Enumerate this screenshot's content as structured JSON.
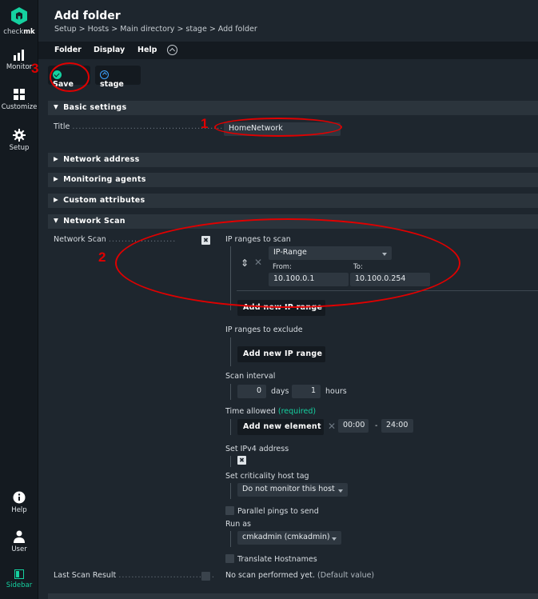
{
  "sidebar": {
    "logo_label_prefix": "check",
    "logo_label_suffix": "mk",
    "items": [
      {
        "label": "Monitor",
        "icon": "bar-chart-icon"
      },
      {
        "label": "Customize",
        "icon": "grid-icon"
      },
      {
        "label": "Setup",
        "icon": "gear-icon"
      },
      {
        "label": "Help",
        "icon": "info-icon"
      },
      {
        "label": "User",
        "icon": "user-icon"
      },
      {
        "label": "Sidebar",
        "icon": "sidebar-toggle-icon"
      }
    ]
  },
  "header": {
    "title": "Add folder",
    "breadcrumb": "Setup > Hosts > Main directory > stage > Add folder"
  },
  "menubar": {
    "items": [
      "Folder",
      "Display",
      "Help"
    ]
  },
  "toolbar": {
    "save_label": "Save",
    "stage_label": "stage"
  },
  "sections": {
    "basic": "Basic settings",
    "network_address": "Network address",
    "monitoring_agents": "Monitoring agents",
    "custom_attributes": "Custom attributes",
    "network_scan": "Network Scan"
  },
  "form": {
    "title_label": "Title",
    "title_dots": "...............................................",
    "title_value": "HomeNetwork",
    "network_scan_label": "Network Scan",
    "network_scan_dots": ".....................",
    "ip_ranges_to_scan": "IP ranges to scan",
    "range_type": "IP-Range",
    "from_label": "From:",
    "to_label": "To:",
    "from_value": "10.100.0.1",
    "to_value": "10.100.0.254",
    "add_ip_range": "Add new IP range",
    "ip_ranges_to_exclude": "IP ranges to exclude",
    "add_ip_range_exclude": "Add new IP range",
    "scan_interval": "Scan interval",
    "interval_days_value": "0",
    "days_label": "days",
    "interval_hours_value": "1",
    "hours_label": "hours",
    "time_allowed": "Time allowed",
    "required": "(required)",
    "add_new_element": "Add new element",
    "time_from": "00:00",
    "time_dash": "-",
    "time_to": "24:00",
    "set_ipv4": "Set IPv4 address",
    "set_criticality": "Set criticality host tag",
    "criticality_value": "Do not monitor this host",
    "parallel_pings": "Parallel pings to send",
    "run_as": "Run as",
    "run_as_value": "cmkadmin (cmkadmin)",
    "translate_hostnames": "Translate Hostnames",
    "last_scan_label": "Last Scan Result",
    "last_scan_dots": "..............................",
    "last_scan_value": "No scan performed yet.",
    "default_value": "(Default value)"
  },
  "annotations": {
    "n1": "1",
    "n2": "2",
    "n3": "3"
  },
  "colors": {
    "accent": "#15d1a0",
    "annotation_red": "#e00000",
    "background": "#1e262e",
    "sidebar": "#141a20"
  }
}
